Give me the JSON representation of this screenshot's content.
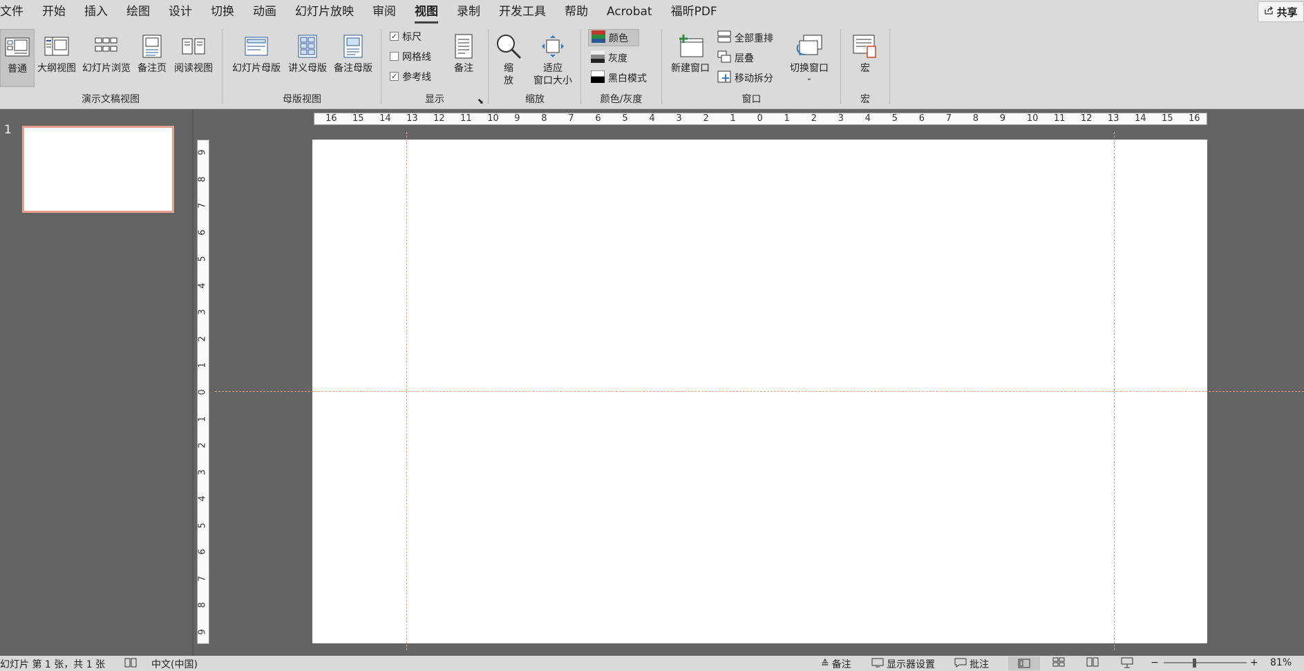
{
  "menu": {
    "tabs": [
      "文件",
      "开始",
      "插入",
      "绘图",
      "设计",
      "切换",
      "动画",
      "幻灯片放映",
      "审阅",
      "视图",
      "录制",
      "开发工具",
      "帮助",
      "Acrobat",
      "福昕PDF"
    ],
    "active_tab": "视图",
    "share_label": "共享"
  },
  "ribbon": {
    "presentation_views": {
      "label": "演示文稿视图",
      "normal": "普通",
      "outline": "大纲视图",
      "slide_sorter": "幻灯片浏览",
      "notes_page": "备注页",
      "reading": "阅读视图"
    },
    "master_views": {
      "label": "母版视图",
      "slide_master": "幻灯片母版",
      "handout_master": "讲义母版",
      "notes_master": "备注母版"
    },
    "show": {
      "label": "显示",
      "ruler": "标尺",
      "gridlines": "网格线",
      "guides": "参考线",
      "notes": "备注",
      "ruler_checked": true,
      "gridlines_checked": false,
      "guides_checked": true
    },
    "zoom": {
      "label": "缩放",
      "zoom": "缩\n放",
      "fit": "适应\n窗口大小"
    },
    "color": {
      "label": "颜色/灰度",
      "color": "颜色",
      "grayscale": "灰度",
      "bw": "黑白模式"
    },
    "window": {
      "label": "窗口",
      "new_window": "新建窗口",
      "arrange_all": "全部重排",
      "cascade": "层叠",
      "move_split": "移动拆分",
      "switch": "切换窗口"
    },
    "macros": {
      "label": "宏",
      "macros": "宏"
    }
  },
  "slides_pane": {
    "slide_number": "1"
  },
  "ruler": {
    "horizontal": [
      "16",
      "15",
      "14",
      "13",
      "12",
      "11",
      "10",
      "9",
      "8",
      "7",
      "6",
      "5",
      "4",
      "3",
      "2",
      "1",
      "0",
      "1",
      "2",
      "3",
      "4",
      "5",
      "6",
      "7",
      "8",
      "9",
      "10",
      "11",
      "12",
      "13",
      "14",
      "15",
      "16"
    ],
    "vertical": [
      "9",
      "8",
      "7",
      "6",
      "5",
      "4",
      "3",
      "2",
      "1",
      "0",
      "1",
      "2",
      "3",
      "4",
      "5",
      "6",
      "7",
      "8",
      "9"
    ]
  },
  "statusbar": {
    "slide_info": "幻灯片 第 1 张，共 1 张",
    "language": "中文(中国)",
    "notes": "备注",
    "display_settings": "显示器设置",
    "comments": "批注",
    "zoom_level": "81%"
  },
  "colors": {
    "guide_orange": "#f0a37c",
    "guide_blue": "#8fb3d9",
    "thumb_border": "#e8a090"
  }
}
